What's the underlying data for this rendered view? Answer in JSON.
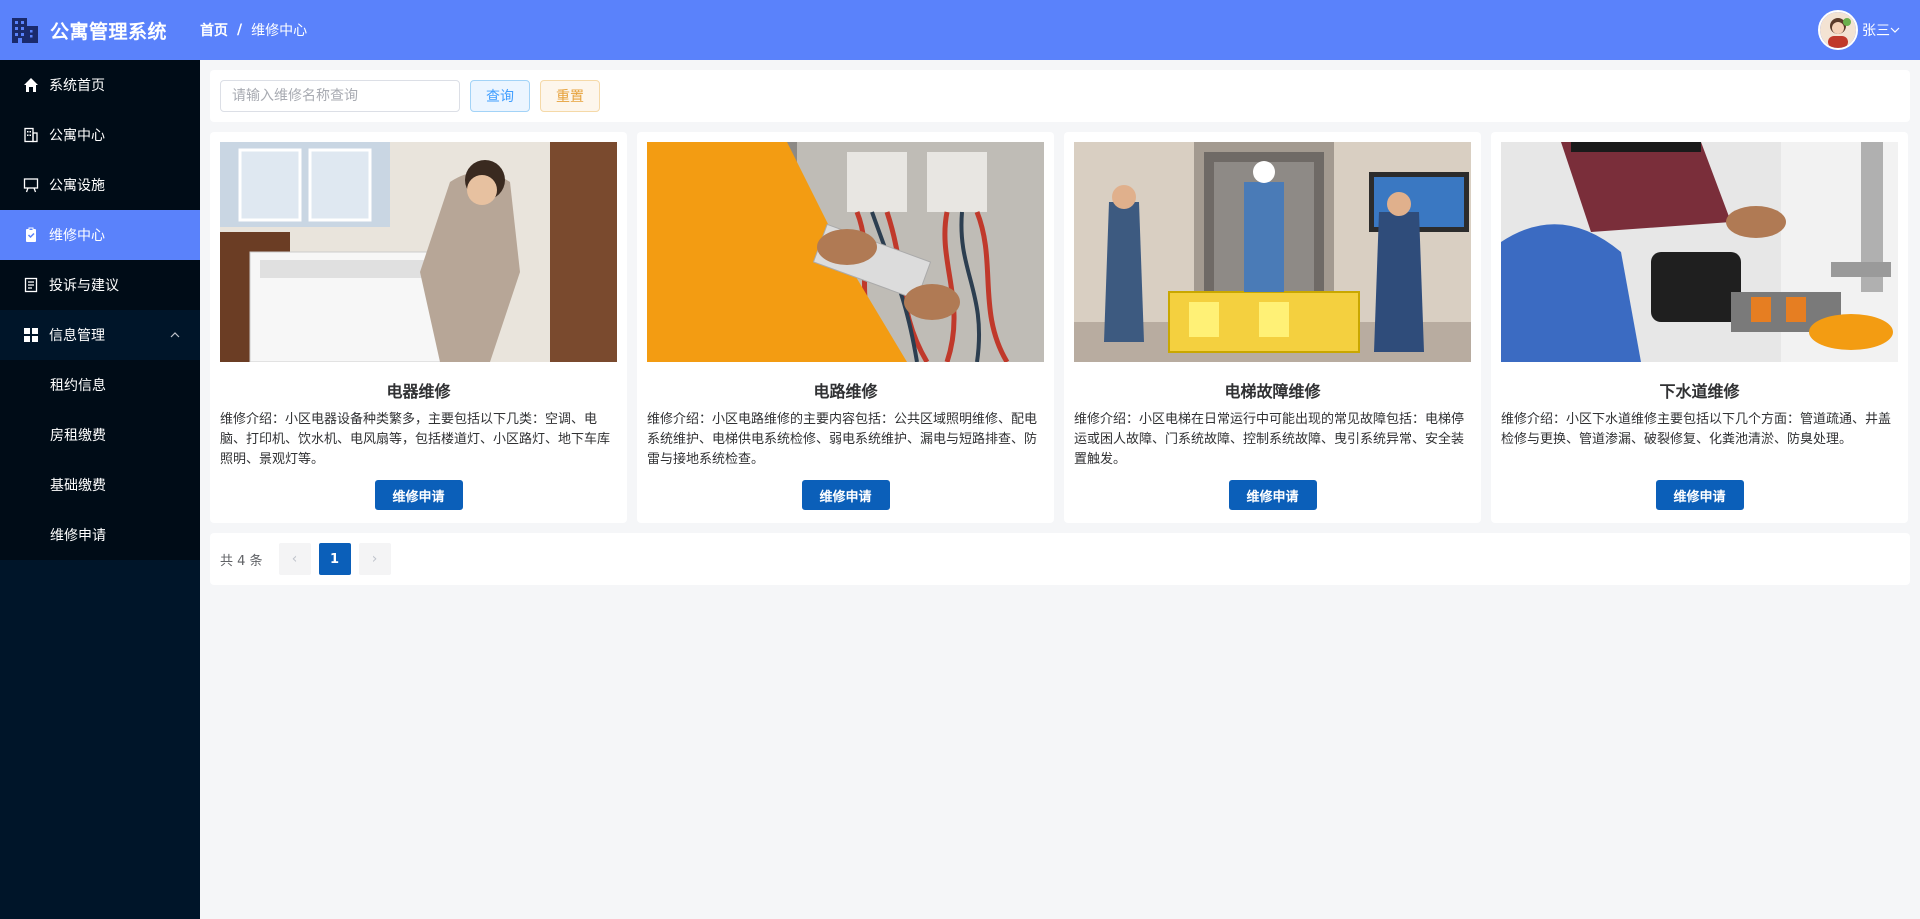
{
  "header": {
    "app_title": "公寓管理系统",
    "breadcrumb": [
      "首页",
      "/",
      "维修中心"
    ],
    "user_name": "张三",
    "brand_color": "#5a82fb"
  },
  "sidebar": {
    "items": [
      {
        "label": "系统首页",
        "icon": "home-icon"
      },
      {
        "label": "公寓中心",
        "icon": "building-icon"
      },
      {
        "label": "公寓设施",
        "icon": "board-icon"
      },
      {
        "label": "维修中心",
        "icon": "clipboard-icon",
        "active": true
      },
      {
        "label": "投诉与建议",
        "icon": "document-icon"
      },
      {
        "label": "信息管理",
        "icon": "grid-icon",
        "expanded": true
      }
    ],
    "sub_items": [
      {
        "label": "租约信息"
      },
      {
        "label": "房租缴费"
      },
      {
        "label": "基础缴费"
      },
      {
        "label": "维修申请"
      }
    ]
  },
  "search": {
    "placeholder": "请输入维修名称查询",
    "value": "",
    "query_label": "查询",
    "reset_label": "重置"
  },
  "cards": [
    {
      "title": "电器维修",
      "desc": "维修介绍：小区电器设备种类繁多，主要包括以下几类：空调、电脑、打印机、饮水机、电风扇等，包括楼道灯、小区路灯、地下车库照明、景观灯等。",
      "button": "维修申请",
      "image": "appliance-repair-photo"
    },
    {
      "title": "电路维修",
      "desc": "维修介绍：小区电路维修的主要内容包括：公共区域照明维修、配电系统维护、电梯供电系统检修、弱电系统维护、漏电与短路排查、防雷与接地系统检查。",
      "button": "维修申请",
      "image": "circuit-repair-photo"
    },
    {
      "title": "电梯故障维修",
      "desc": "维修介绍：小区电梯在日常运行中可能出现的常见故障包括：电梯停运或困人故障、门系统故障、控制系统故障、曳引系统异常、安全装置触发。",
      "button": "维修申请",
      "image": "elevator-repair-photo"
    },
    {
      "title": "下水道维修",
      "desc": "维修介绍：小区下水道维修主要包括以下几个方面：管道疏通、井盖检修与更换、管道渗漏、破裂修复、化粪池清淤、防臭处理。",
      "button": "维修申请",
      "image": "sewer-repair-photo"
    }
  ],
  "pagination": {
    "total_text": "共 4 条",
    "current_page": "1",
    "prev": "‹",
    "next": "›"
  }
}
